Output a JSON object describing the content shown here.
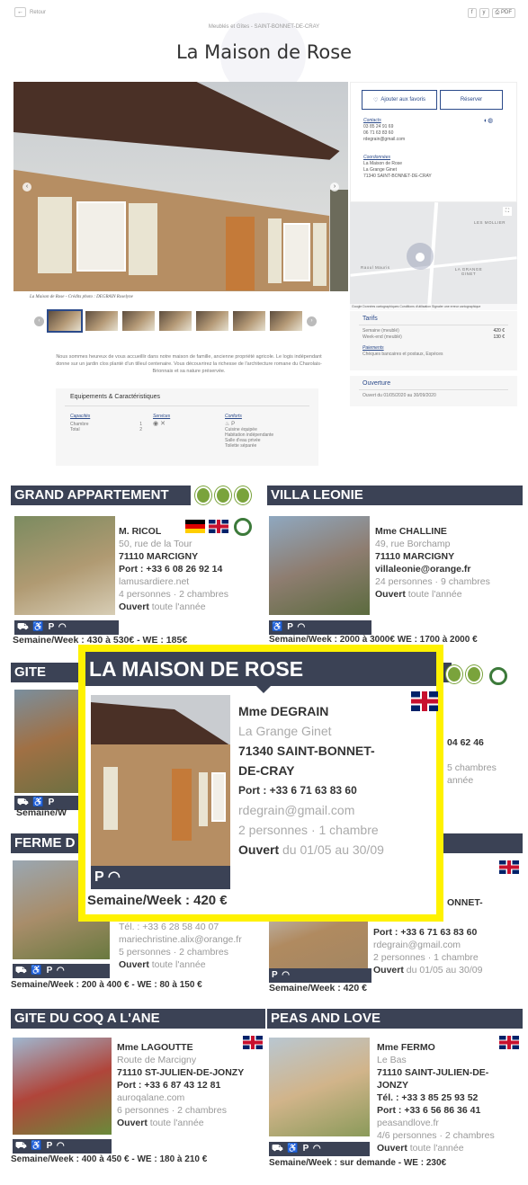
{
  "page": {
    "back_label": "Retour",
    "share": [
      "f",
      "y",
      "PDF"
    ],
    "subtitle": "Meublés et Gîtes - SAINT-BONNET-DE-CRAY",
    "title": "La Maison de Rose",
    "photo_caption": "La Maison de Rose - Crédits photo : DEGRAIN Roselyne",
    "description": "Nous sommes heureux de vous accueillir dans notre maison de famille, ancienne propriété agricole. Le logis indépendant donne sur un jardin clos planté d'un tilleul centenaire. Vous découvrirez la richesse de l'architecture romane du Charolais-Brionnais et sa nature préservée.",
    "equip": {
      "title": "Equipements & Caractéristiques",
      "cap_title": "Capacités",
      "cap_rows": [
        [
          "Chambre",
          "1"
        ],
        [
          "Total",
          "2"
        ]
      ],
      "serv_title": "Services",
      "conf_title": "Conforts",
      "conf_items": [
        "Cuisine équipée",
        "Habitation indépendante",
        "Salle d'eau privée",
        "Toilette séparée"
      ]
    },
    "sidebar": {
      "fav_label": "Ajouter aux favoris",
      "book_label": "Réserver",
      "contacts_label": "Contacts",
      "contacts": [
        "03 85 24 91 69",
        "06 71 63 83 60",
        "rdegrain@gmail.com"
      ],
      "coords_label": "Coordonnées",
      "coords": [
        "La Maison de Rose",
        "La Grange Ginet",
        "71340 SAINT-BONNET-DE-CRAY"
      ]
    },
    "map": {
      "labels": [
        "LES MOLLIER",
        "Raoul Mauris",
        "LA GRANGE GINET"
      ],
      "credit": "Google  Données cartographiques  Conditions d'utilisation  Signaler une erreur cartographique"
    },
    "tarifs": {
      "title": "Tarifs",
      "rows": [
        [
          "Semaine (meublé)",
          "420 €"
        ],
        [
          "Week-end (meublé)",
          "130 €"
        ]
      ],
      "pay_label": "Paiements",
      "pay": "Chèques bancaires et postaux, Espèces"
    },
    "ouverture": {
      "title": "Ouverture",
      "text": "Ouvert du 01/05/2020 au 30/09/2020"
    }
  },
  "brochure": {
    "grand": {
      "title": "GRAND APPARTEMENT",
      "lines": [
        "M. RICOL",
        "50, rue de la Tour",
        "71110 MARCIGNY",
        "Port : +33 6 08 26 92 14",
        "lamusardiere.net",
        "4 personnes · 2 chambres"
      ],
      "open": [
        "Ouvert",
        "toute l'année"
      ],
      "price": "Semaine/Week : 430 à 530€ - WE : 185€"
    },
    "villa": {
      "title": "VILLA LEONIE",
      "lines": [
        "Mme CHALLINE",
        "49, rue Borchamp",
        "71110 MARCIGNY",
        "villaleonie@orange.fr",
        "24 personnes · 9 chambres"
      ],
      "open": [
        "Ouvert",
        "toute l'année"
      ],
      "price": "Semaine/Week : 2000 à 3000€ WE : 1700 à 2000 €"
    },
    "gite": {
      "title": "GITE",
      "price": "Semaine/W",
      "right_lines": [
        "04 62 46",
        "5 chambres",
        "année"
      ]
    },
    "ferme": {
      "title": "FERME D",
      "lines": [
        "Tél. : +33 6 28 58 40 07",
        "mariechristine.alix@orange.fr",
        "5 personnes · 2 chambres"
      ],
      "open": [
        "Ouvert",
        "toute l'année"
      ],
      "price": "Semaine/Week : 200 à 400 € - WE : 80 à 150 €"
    },
    "rose_small": {
      "lines": [
        "ONNET-",
        "Port : +33 6 71 63 83 60",
        "rdegrain@gmail.com",
        "2 personnes · 1 chambre"
      ],
      "open": [
        "Ouvert",
        "du 01/05 au 30/09"
      ],
      "price": "Semaine/Week : 420 €"
    },
    "highlight": {
      "title": "LA MAISON DE ROSE",
      "lines": [
        "Mme DEGRAIN",
        "La Grange Ginet",
        "71340 SAINT-BONNET-",
        "DE-CRAY",
        "Port : +33 6 71 63 83 60",
        "rdegrain@gmail.com",
        "2 personnes · 1 chambre"
      ],
      "open": [
        "Ouvert",
        "du 01/05 au 30/09"
      ],
      "price": "Semaine/Week : 420 €"
    },
    "coq": {
      "title": "GITE DU COQ A L'ANE",
      "lines": [
        "Mme LAGOUTTE",
        "Route de Marcigny",
        "71110 ST-JULIEN-DE-JONZY",
        "Port : +33 6 87 43 12 81",
        "auroqalane.com",
        "6 personnes · 2 chambres"
      ],
      "open": [
        "Ouvert",
        "toute l'année"
      ],
      "price": "Semaine/Week : 400 à 450 € - WE : 180 à 210 €"
    },
    "peas": {
      "title": "PEAS AND LOVE",
      "lines": [
        "Mme FERMO",
        "Le Bas",
        "71110 SAINT-JULIEN-DE-",
        "JONZY",
        "Tél. : +33 3 85 25 93 52",
        "Port : +33 6 56 86 36 41",
        "peasandlove.fr",
        "4/6 personnes · 2 chambres"
      ],
      "open": [
        "Ouvert",
        "toute l'année"
      ],
      "price": "Semaine/Week : sur demande - WE : 230€"
    }
  }
}
